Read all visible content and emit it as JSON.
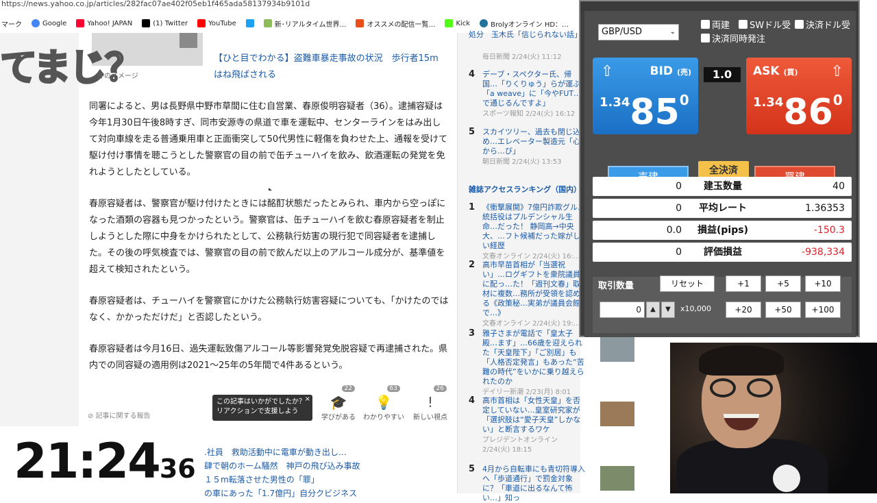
{
  "browser": {
    "url": "https://news.yahoo.co.jp/articles/282fac07ae402f05eb1f465ada58137934b9101d",
    "bookmarks": [
      {
        "label": "マーク",
        "icon": "bookmark-icon",
        "color": "#ffffff"
      },
      {
        "label": "Google",
        "icon": "google-icon",
        "color": "#4285f4"
      },
      {
        "label": "Yahoo! JAPAN",
        "icon": "yahoo-icon",
        "color": "#ff0033"
      },
      {
        "label": "(1) Twitter",
        "icon": "x-icon",
        "color": "#000000"
      },
      {
        "label": "YouTube",
        "icon": "youtube-icon",
        "color": "#ff0000"
      },
      {
        "label": "",
        "icon": "twitter-bird-icon",
        "color": "#1da1f2"
      },
      {
        "label": "新･リアルタイム世界…",
        "icon": "news-icon",
        "color": "#8fbc5a"
      },
      {
        "label": "オススメの配信一覧…",
        "icon": "stream-icon",
        "color": "#e94e1b"
      },
      {
        "label": "Kick",
        "icon": "kick-icon",
        "color": "#53fc18"
      },
      {
        "label": "Brolyオンライン HD：…",
        "icon": "wordpress-icon",
        "color": "#21759b"
      },
      {
        "label": "",
        "icon": "lock-icon",
        "color": "#888888"
      }
    ]
  },
  "overlay_text": "てまじ？",
  "article": {
    "image_caption": "件のイメージ",
    "related_link": "【ひと目でわかる】盗難車暴走事故の状況　歩行者15m はね飛ばされる",
    "paragraphs": [
      "同署によると、男は長野県中野市草間に住む自営業、春原俊明容疑者（36）。逮捕容疑は今年1月30日午後8時すぎ、同市安源寺の県道で車を運転中、センターラインをはみ出して対向車線を走る普通乗用車と正面衝突して50代男性に軽傷を負わせた上、通報を受けて駆け付け事情を聴こうとした警察官の目の前で缶チューハイを飲み、飲酒運転の発覚を免れようとしたとしている。",
      "春原容疑者は、警察官が駆け付けたときには酩酊状態だったとみられ、車内から空っぽになった酒類の容器も見つかったという。警察官は、缶チューハイを飲む春原容疑者を制止しようとした際に中身をかけられたとして、公務執行妨害の現行犯で同容疑者を逮捕した。その後の呼気検査では、警察官の目の前で飲んだ以上のアルコール成分が、基準値を超えて検知されたという。",
      "春原容疑者は、チューハイを警察官にかけた公務執行妨害容疑についても、「かけたのではなく、かかっただけだ」と否認したという。",
      "春原容疑者は今月16日、過失運転致傷アルコール等影響発覚免脱容疑で再逮捕された。県内での同容疑の適用例は2021～25年の5年間で4件あるという。"
    ],
    "report_link": "記事に関する報告",
    "tooltip": "この記事はいかがでしたか？リアクションで支援しよう",
    "tooltip_close": "×",
    "reactions": [
      {
        "label": "学びがある",
        "count": "22",
        "icon": "graduation-cap-icon"
      },
      {
        "label": "わかりやすい",
        "count": "63",
        "icon": "lightbulb-icon"
      },
      {
        "label": "新しい視点",
        "count": "26",
        "icon": "exclamation-icon"
      }
    ],
    "bottom_links": [
      ".社員　救助活動中に電車が動き出し…",
      "肆で朝のホーム騒然　神戸の飛び込み事故",
      "１５m転落させた男性の「罪」",
      "の車にあった「1.7億円」自分クビジネス"
    ]
  },
  "clock": {
    "hm": "21:24",
    "sec": "36"
  },
  "sidebar": {
    "top_item": {
      "title": "処分　玉木氏「信じられない話」",
      "source": "毎日新聞 2/24(火) 11:12"
    },
    "items": [
      {
        "rank": "4",
        "title": "デーブ・スペクター氏、帰国…「りくりゅう」らが運ぶ「a weave」に「今やFUT…で通じるんですよ」",
        "source": "スポーツ報知 2/24(火) 16:12"
      },
      {
        "rank": "5",
        "title": "スカイツリー、過去も閉じ込め…エレベーター製造元「心から…び」",
        "source": "朝日新聞 2/24(火) 13:53"
      }
    ],
    "ranking_title": "雑誌アクセスランキング（国内）",
    "ranking": [
      {
        "rank": "1",
        "title": "《衝撃展開》7億円詐欺グル…統括役はプルデンシャル生命…だった！ 静岡高→中央大、…フト候補だった嫁がしい経歴",
        "source": "文春オンライン 2/24(火) 16:…"
      },
      {
        "rank": "2",
        "title": "高市早苗首相が「当選祝い」…ログギフトを衆院議員に配っ…た！「週刊文春」取材に複数…務所が受領を認める《政策秘…実弟が議員会館で…》",
        "source": "文春オンライン 2/24(火) 19:…"
      },
      {
        "rank": "3",
        "title": "雅子さまが電話で「皇太子殿…ます」…66歳を迎えられた「天皇陛下」「ご別居」も「人格否定発言」もあった“苦難の時代”をいかに乗り越えられたのか",
        "source": "デイリー新潮 2/23(月) 8:01"
      },
      {
        "rank": "4",
        "title": "高市首相は「女性天皇」を否定していない…皇室研究家が「選択肢は“愛子天皇”しかない」と断言するワケ",
        "source": "プレジデントオンライン 2/24(火) 18:15"
      },
      {
        "rank": "5",
        "title": "4月から自転車にも青切符導入へ「歩道通行」で罰金対象に？「車道に出るなんて怖い…」知っ",
        "source": ""
      }
    ]
  },
  "trading": {
    "pair": "GBP/USD",
    "checks": [
      "両建",
      "SWドル受",
      "決済ドル受",
      "決済同時発注"
    ],
    "bid": {
      "label": "BID",
      "sub": "(売)",
      "big": "1.34",
      "main": "85",
      "pip": "0"
    },
    "ask": {
      "label": "ASK",
      "sub": "(買)",
      "big": "1.34",
      "main": "86",
      "pip": "0"
    },
    "spread": "1.0",
    "tab_sell": "売建",
    "tab_close": "全決済",
    "tab_buy": "買建",
    "rows": [
      {
        "label": "建玉数量",
        "sell": "0",
        "buy": "40"
      },
      {
        "label": "平均レート",
        "sell": "0",
        "buy": "1.36353"
      },
      {
        "label": "損益(pips)",
        "sell": "0.0",
        "buy": "-150.3"
      },
      {
        "label": "評価損益",
        "sell": "0",
        "buy": "-938,334"
      }
    ],
    "qty_label": "取引数量",
    "reset": "リセット",
    "buttons_row1": [
      "+1",
      "+5",
      "+10"
    ],
    "buttons_row2": [
      "+20",
      "+50",
      "+100"
    ],
    "qty_value": "0",
    "unit": "x10,000",
    "colors": {
      "bid": "#1b6fc4",
      "ask": "#d3331a",
      "negative": "#e0202a",
      "close": "#f5c04a"
    }
  }
}
